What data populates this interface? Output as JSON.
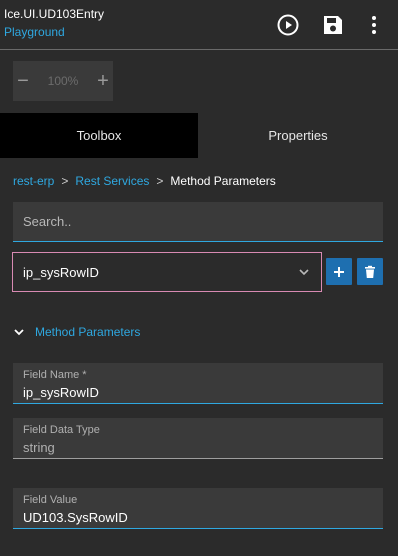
{
  "header": {
    "title": "Ice.UI.UD103Entry",
    "subtitle": "Playground",
    "icons": [
      "play-circle-icon",
      "save-icon",
      "more-vertical-icon"
    ]
  },
  "zoom": {
    "minus": "−",
    "value": "100%",
    "plus": "+"
  },
  "tabs": [
    {
      "label": "Toolbox",
      "active": true
    },
    {
      "label": "Properties",
      "active": false
    }
  ],
  "breadcrumb": {
    "items": [
      "rest-erp",
      "Rest Services",
      "Method Parameters"
    ],
    "separator": ">"
  },
  "search": {
    "placeholder": "Search..",
    "value": ""
  },
  "method_select": {
    "value": "ip_sysRowID"
  },
  "section": {
    "title": "Method Parameters",
    "expanded": true
  },
  "fields": {
    "field_name": {
      "label": "Field Name *",
      "value": "ip_sysRowID"
    },
    "field_data_type": {
      "label": "Field Data Type",
      "value": "string"
    },
    "field_value": {
      "label": "Field Value",
      "value": "UD103.SysRowID"
    }
  },
  "colors": {
    "accent": "#2fa8e0",
    "button": "#1e6fb0",
    "background": "#2b2b2b",
    "field_bg": "#3a3a3a",
    "invalid_border": "#d98ab3"
  }
}
